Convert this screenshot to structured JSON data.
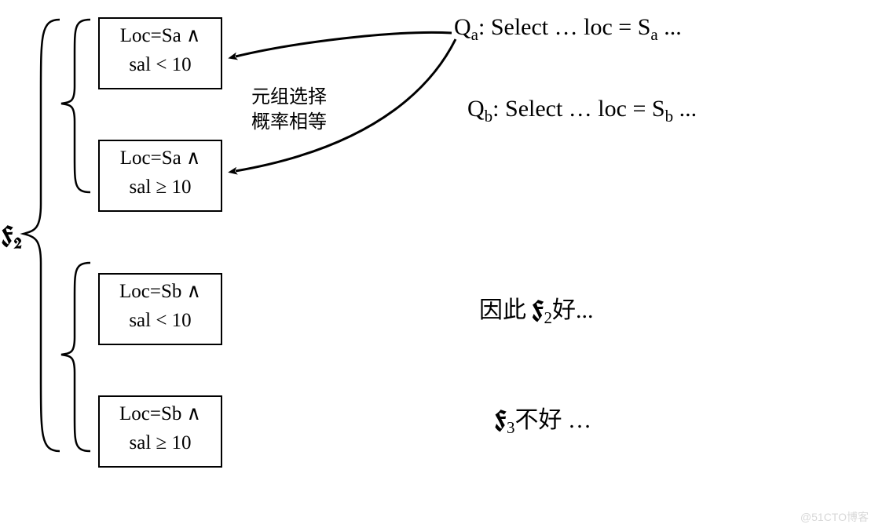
{
  "boxes": {
    "b1": {
      "line1": "Loc=Sa ∧",
      "line2": "sal < 10"
    },
    "b2": {
      "line1": "Loc=Sa ∧",
      "line2": "sal ≥ 10"
    },
    "b3": {
      "line1": "Loc=Sb ∧",
      "line2": "sal < 10"
    },
    "b4": {
      "line1": "Loc=Sb ∧",
      "line2": "sal ≥ 10"
    }
  },
  "queries": {
    "qa_prefix": "Q",
    "qa_sub": "a",
    "qa_body": ": Select … loc = S",
    "qa_sub2": "a",
    "qa_tail": " ...",
    "qb_prefix": "Q",
    "qb_sub": "b",
    "qb_body": ": Select … loc = S",
    "qb_sub2": "b",
    "qb_tail": " ..."
  },
  "note": {
    "line1": "元组选择",
    "line2": "概率相等"
  },
  "label_f2": "F",
  "label_f2_sub": "2",
  "conclusions": {
    "c1_pre": "因此 ",
    "c1_f": "F",
    "c1_sub": "2",
    "c1_post": "好...",
    "c2_f": "F",
    "c2_sub": "3",
    "c2_post": "不好 …"
  },
  "watermark": "@51CTO博客"
}
